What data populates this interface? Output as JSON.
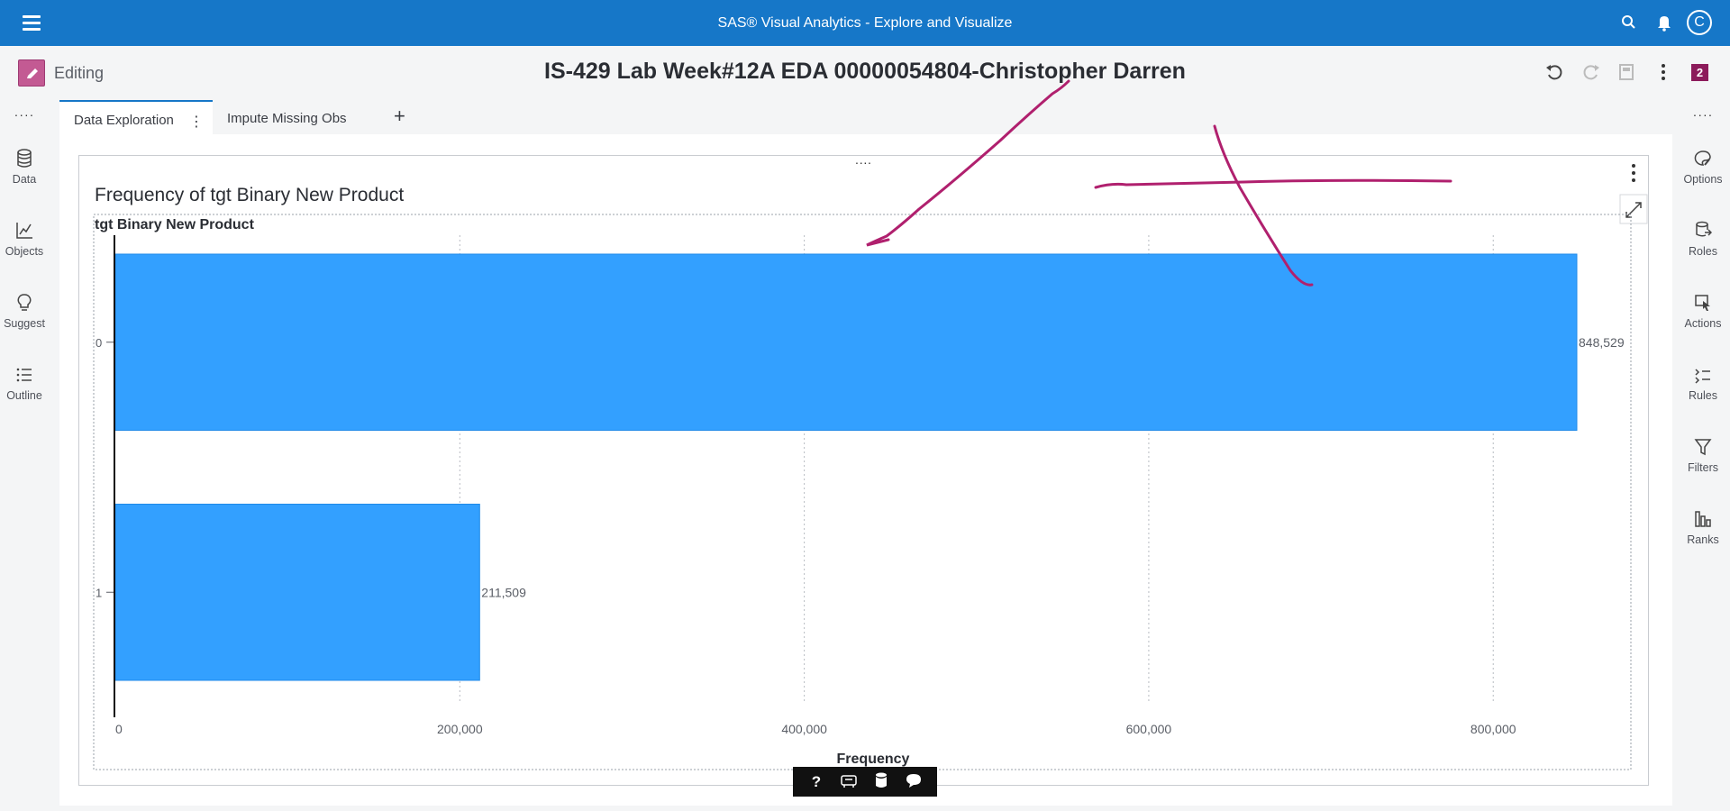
{
  "app": {
    "title": "SAS® Visual Analytics - Explore and Visualize",
    "avatar_initial": "C"
  },
  "header": {
    "mode_label": "Editing",
    "report_title": "IS-429 Lab Week#12A EDA 00000054804-Christopher Darren",
    "badge_count": "2"
  },
  "left_sidebar": [
    {
      "label": "Data",
      "icon": "database-icon"
    },
    {
      "label": "Objects",
      "icon": "line-chart-icon"
    },
    {
      "label": "Suggest",
      "icon": "lightbulb-icon"
    },
    {
      "label": "Outline",
      "icon": "list-icon"
    }
  ],
  "right_sidebar": [
    {
      "label": "Options",
      "icon": "palette-icon"
    },
    {
      "label": "Roles",
      "icon": "roles-icon"
    },
    {
      "label": "Actions",
      "icon": "cursor-icon"
    },
    {
      "label": "Rules",
      "icon": "rules-icon"
    },
    {
      "label": "Filters",
      "icon": "filter-icon"
    },
    {
      "label": "Ranks",
      "icon": "ranks-icon"
    }
  ],
  "tabs": [
    {
      "label": "Data Exploration",
      "active": true
    },
    {
      "label": "Impute Missing Obs",
      "active": false
    }
  ],
  "colors": {
    "appbar": "#1677c8",
    "bar": "#33a0ff",
    "bar_border": "#1f8ae8",
    "annotation": "#b0206e",
    "badge": "#8c1b5b"
  },
  "chart_data": {
    "type": "bar",
    "orientation": "horizontal",
    "title": "Frequency of tgt Binary New Product",
    "ylabel": "tgt Binary New Product",
    "xlabel": "Frequency",
    "categories": [
      "0",
      "1"
    ],
    "values": [
      848529,
      211509
    ],
    "value_labels": [
      "848,529",
      "211,509"
    ],
    "xlim": [
      0,
      848529
    ],
    "xticks": [
      0,
      200000,
      400000,
      600000,
      800000
    ],
    "xtick_labels": [
      "0",
      "200,000",
      "400,000",
      "600,000",
      "800,000"
    ],
    "grid": "vertical dotted"
  },
  "bottom_toolbar": [
    "help-icon",
    "accessibility-icon",
    "data-icon",
    "comment-icon"
  ]
}
